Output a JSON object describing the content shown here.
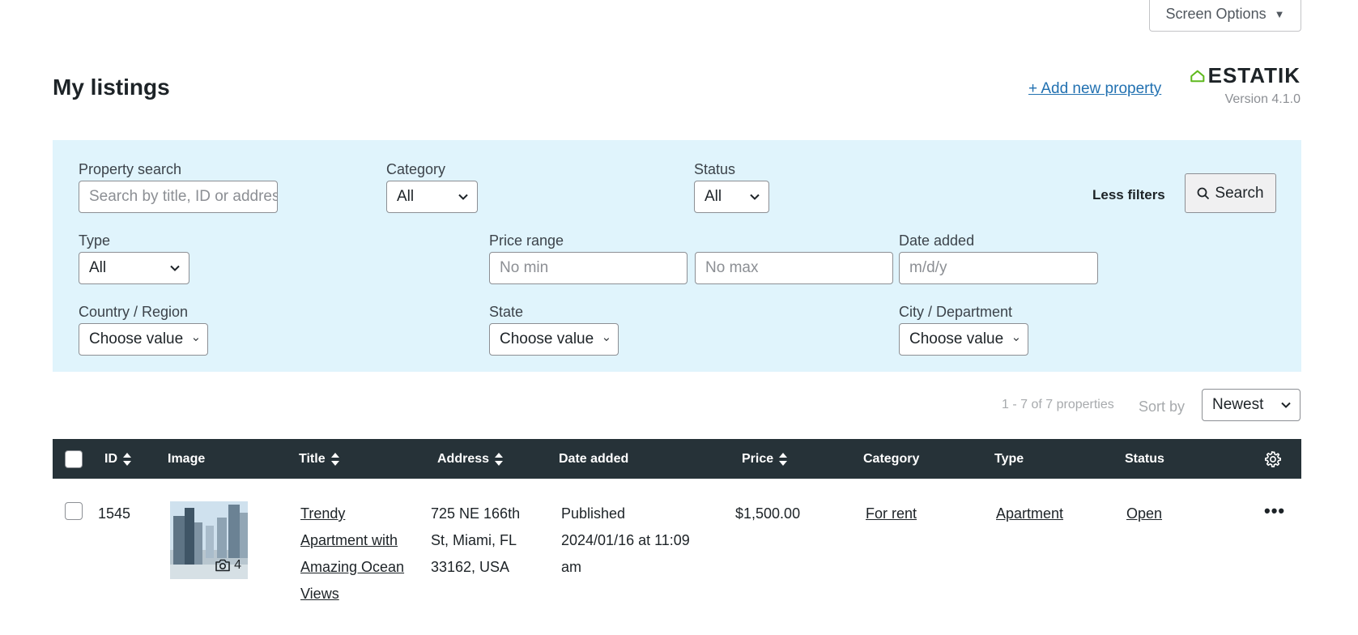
{
  "screen_options": {
    "label": "Screen Options",
    "caret": "▼"
  },
  "page": {
    "title": "My listings",
    "add_new_label": "+ Add new property"
  },
  "brand": {
    "name": "ESTATIK",
    "version": "Version 4.1.0",
    "logo_icon": "house-icon",
    "color": "#5fb91e"
  },
  "filters": {
    "property_search": {
      "label": "Property search",
      "placeholder": "Search by title, ID or address"
    },
    "category": {
      "label": "Category",
      "value": "All"
    },
    "status": {
      "label": "Status",
      "value": "All"
    },
    "less_filters": "Less filters",
    "search_button": "Search",
    "type": {
      "label": "Type",
      "value": "All"
    },
    "price_range": {
      "label": "Price range",
      "min_placeholder": "No min",
      "max_placeholder": "No max"
    },
    "date_added": {
      "label": "Date added",
      "placeholder": "m/d/y"
    },
    "country": {
      "label": "Country / Region",
      "value": "Choose value"
    },
    "state": {
      "label": "State",
      "value": "Choose value"
    },
    "city": {
      "label": "City / Department",
      "value": "Choose value"
    },
    "background": "#e0f4fc"
  },
  "results": {
    "count": "1 - 7 of 7 properties",
    "sort_label": "Sort by",
    "sort_value": "Newest"
  },
  "table": {
    "header_bg": "#263238",
    "columns": {
      "id": "ID",
      "image": "Image",
      "title": "Title",
      "address": "Address",
      "date_added": "Date added",
      "price": "Price",
      "category": "Category",
      "type": "Type",
      "status": "Status"
    },
    "rows": [
      {
        "id": "1545",
        "image_count": "4",
        "title": "Trendy Apartment with Amazing Ocean Views",
        "address": "725 NE 166th St, Miami, FL 33162, USA",
        "date_status": "Published",
        "date": "2024/01/16 at 11:09 am",
        "price": "$1,500.00",
        "category": "For rent",
        "type": "Apartment",
        "status": "Open",
        "actions": "•••"
      }
    ]
  }
}
